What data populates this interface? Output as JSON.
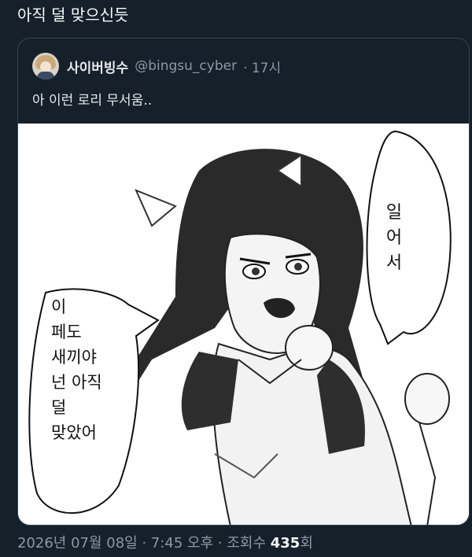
{
  "tweet": {
    "text": "아직 덜 맞으신듯"
  },
  "quoted": {
    "display_name": "사이버빙수",
    "handle": "@bingsu_cyber",
    "time": "· 17시",
    "text": "아 이런 로리 무서움..",
    "avatar_icon": "user-avatar-icon"
  },
  "media": {
    "bubble_right_lines": [
      "일",
      "어",
      "서"
    ],
    "bubble_left_lines": [
      "이",
      "페도",
      "새끼야",
      "넌 아직",
      "덜",
      "맞았어"
    ]
  },
  "meta": {
    "date_time": "2026년 07월 08일 · 7:45 오후 · 조회수 ",
    "views_count": "435",
    "views_suffix": "회"
  },
  "colors": {
    "background": "#15202b",
    "border": "#38444d",
    "secondary_text": "#8b98a5",
    "primary_text": "#e7e9ea"
  }
}
